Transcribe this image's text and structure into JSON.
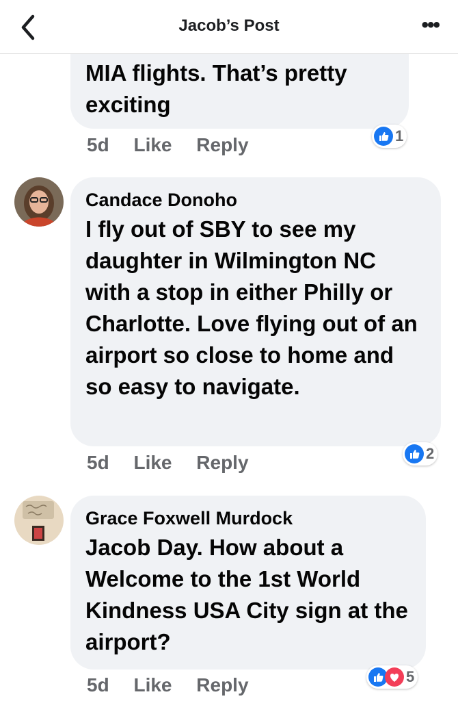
{
  "header": {
    "title": "Jacob’s Post",
    "back_icon": "chevron-left-icon",
    "more_label": "•••"
  },
  "comments": [
    {
      "text": "MIA flights. That’s pretty exciting",
      "time": "5d",
      "like_label": "Like",
      "reply_label": "Reply",
      "reactions": {
        "types": [
          "like"
        ],
        "count": "1"
      }
    },
    {
      "author": "Candace Donoho",
      "text": "I fly out of SBY to see my daughter in Wilmington NC with a stop in either Philly or Charlotte. Love flying out of an airport so close to home and so easy to navigate.",
      "time": "5d",
      "like_label": "Like",
      "reply_label": "Reply",
      "reactions": {
        "types": [
          "like"
        ],
        "count": "2"
      }
    },
    {
      "author": "Grace Foxwell Murdock",
      "mention": "Jacob Day",
      "text": ". How about a Welcome to the  1st World Kindness USA City sign at the airport?",
      "time": "5d",
      "like_label": "Like",
      "reply_label": "Reply",
      "reactions": {
        "types": [
          "like",
          "love"
        ],
        "count": "5"
      }
    }
  ],
  "colors": {
    "like_blue": "#1877f2",
    "love_red": "#f33e58",
    "bubble_bg": "#f0f2f5",
    "meta_gray": "#65676b"
  }
}
